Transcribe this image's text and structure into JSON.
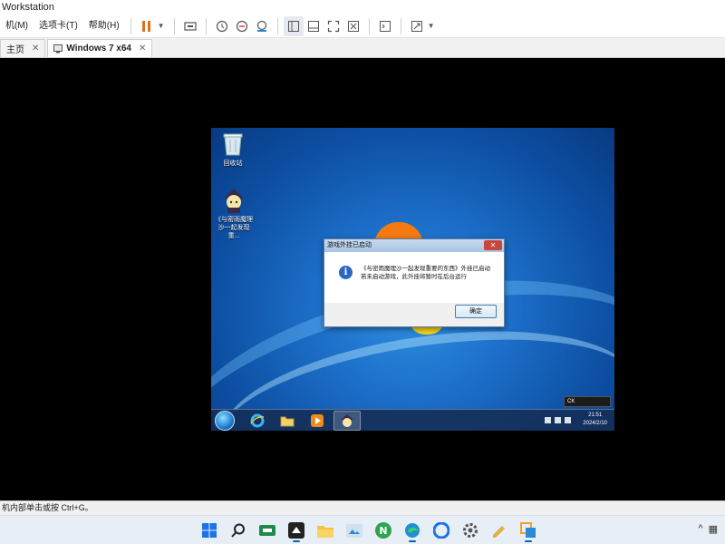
{
  "window": {
    "title": "Workstation"
  },
  "menu": {
    "items": [
      "机(M)",
      "选项卡(T)",
      "帮助(H)"
    ]
  },
  "tabs": [
    {
      "label": "主页",
      "active": false
    },
    {
      "label": "Windows 7 x64",
      "active": true
    }
  ],
  "guest": {
    "desktop_icons": [
      {
        "name": "recycle-bin",
        "label": "回收站"
      },
      {
        "name": "app-shortcut",
        "label": "《与密雨魔理沙一起发现重..."
      }
    ],
    "dialog": {
      "title": "游戏外挂已启动",
      "close_glyph": "✕",
      "info_glyph": "i",
      "line1": "《与密雨魔理沙一起发现重要的东西》外挂已启动",
      "line2": "若未启动游戏，此外挂将暂时在后台运行",
      "ok_label": "确定"
    },
    "langbar": "CK",
    "tray": {
      "time": "21:51",
      "date": "2024/2/10"
    }
  },
  "status": {
    "text": "机内部单击或按 Ctrl+G。"
  },
  "colors": {
    "accent": "#0067c0",
    "pause": "#e07020",
    "dialog_close": "#c9463d"
  }
}
